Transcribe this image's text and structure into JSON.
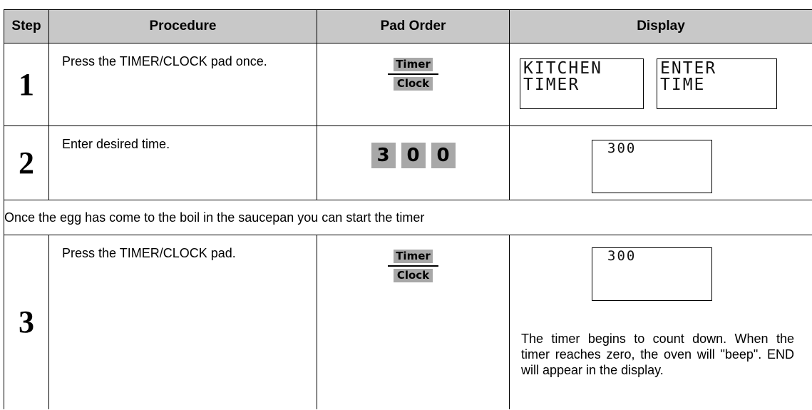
{
  "headers": {
    "step": "Step",
    "procedure": "Procedure",
    "pad_order": "Pad Order",
    "display": "Display"
  },
  "rows": [
    {
      "step": "1",
      "procedure": "Press the TIMER/CLOCK pad once.",
      "pad": {
        "top": "Timer",
        "bottom": "Clock"
      },
      "display": [
        "KITCHEN\nTIMER",
        "ENTER\nTIME"
      ]
    },
    {
      "step": "2",
      "procedure": "Enter desired time.",
      "pad_keys": [
        "3",
        "0",
        "0"
      ],
      "display": [
        "300"
      ]
    },
    {
      "step": "3",
      "procedure": "Press the TIMER/CLOCK pad.",
      "pad": {
        "top": "Timer",
        "bottom": "Clock"
      },
      "display": [
        "300"
      ],
      "note": "The timer begins to count down. When the timer reaches zero, the oven will \"beep\". END will appear in the display."
    }
  ],
  "middle_note": "Once the egg has come to the boil in the saucepan you can start the timer"
}
